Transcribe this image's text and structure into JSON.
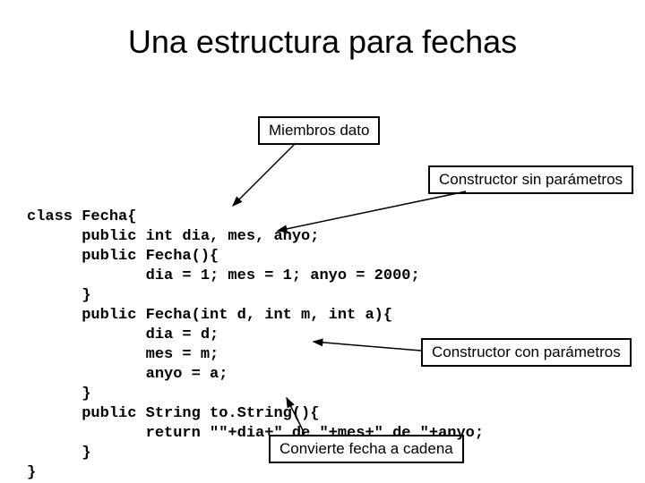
{
  "title": "Una estructura para fechas",
  "labels": {
    "members": "Miembros dato",
    "ctor0": "Constructor sin parámetros",
    "ctorn": "Constructor con parámetros",
    "tostr": "Convierte fecha a cadena"
  },
  "code": {
    "l1": "class Fecha{",
    "l2": "      public int dia, mes, anyo;",
    "l3": "      public Fecha(){",
    "l4": "             dia = 1; mes = 1; anyo = 2000;",
    "l5": "      }",
    "l6": "      public Fecha(int d, int m, int a){",
    "l7": "             dia = d;",
    "l8": "             mes = m;",
    "l9": "             anyo = a;",
    "l10": "      }",
    "l11": "      public String to.String(){",
    "l12": "             return \"\"+dia+\" de \"+mes+\" de \"+anyo;",
    "l13": "      }",
    "l14": "}"
  }
}
